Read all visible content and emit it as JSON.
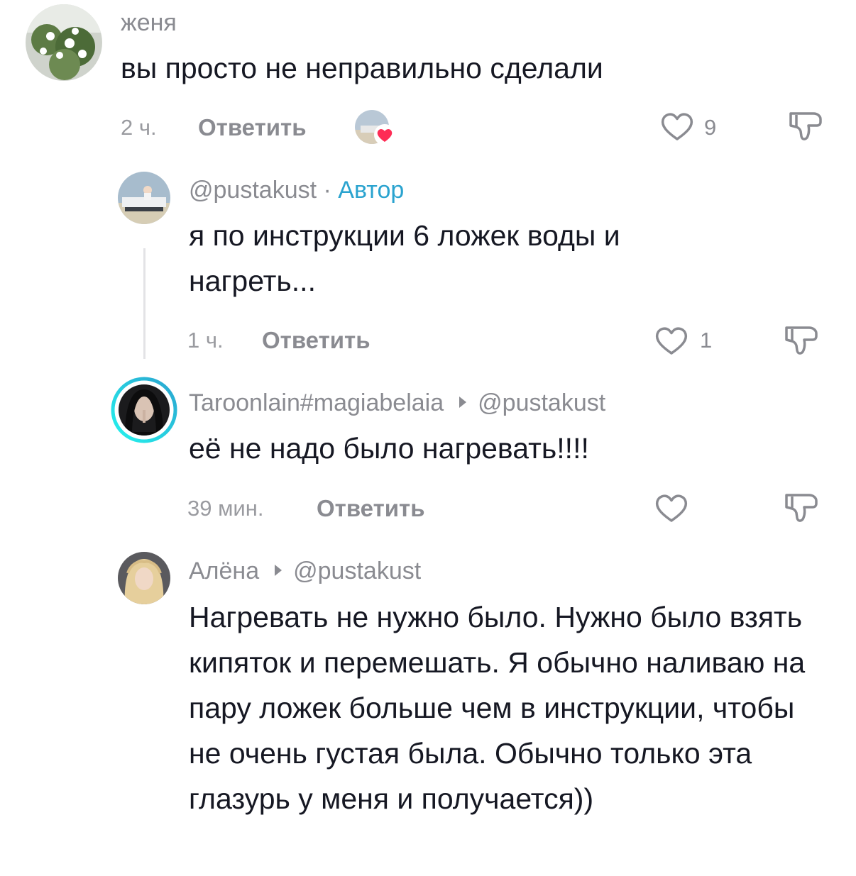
{
  "comments": [
    {
      "username": "женя",
      "text": "вы просто не неправильно сделали",
      "time": "2 ч.",
      "reply_label": "Ответить",
      "likes": "9",
      "creator_liked": true
    },
    {
      "username": "@pustakust",
      "separator": "·",
      "badge": "Автор",
      "text": "я по инструкции 6 ложек воды и нагреть...",
      "time": "1 ч.",
      "reply_label": "Ответить",
      "likes": "1"
    },
    {
      "username": "Taroonlain#magiabelaia",
      "reply_to": "@pustakust",
      "text": "её не надо было нагревать!!!!",
      "time": "39 мин.",
      "reply_label": "Ответить",
      "likes": ""
    },
    {
      "username": "Алёна",
      "reply_to": "@pustakust",
      "text": "Нагревать не нужно было. Нужно было взять кипяток и перемешать. Я обычно наливаю на пару ложек больше чем в инструкции, чтобы не очень густая была. Обычно только эта глазурь у меня и получается))",
      "time": "",
      "reply_label": "",
      "likes": ""
    }
  ],
  "colors": {
    "author_badge": "#2aa3cf",
    "meta_text": "#8a8b91",
    "liked_heart": "#fe2c55",
    "live_ring_start": "#25f4ee",
    "live_ring_end": "#2aa3cf"
  },
  "icons": [
    "heart-outline-icon",
    "dislike-icon",
    "heart-filled-icon"
  ]
}
